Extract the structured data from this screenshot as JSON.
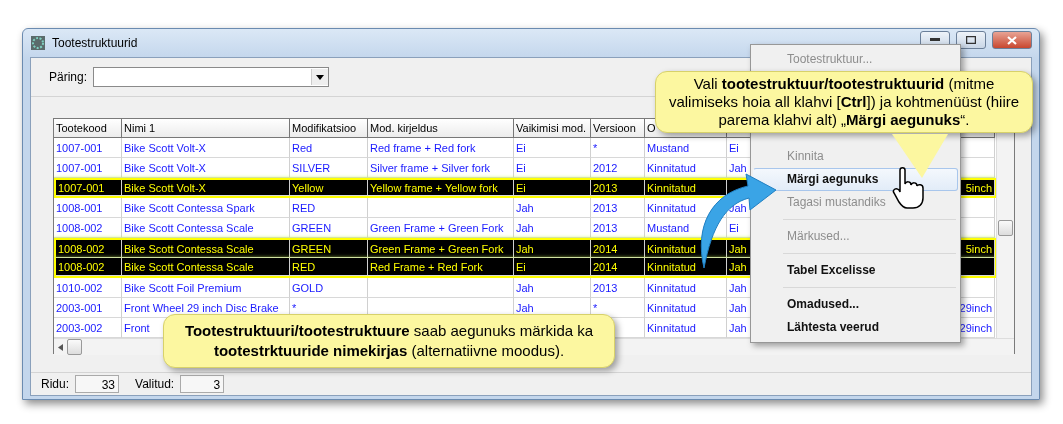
{
  "window": {
    "title": "Tootestruktuurid"
  },
  "query": {
    "label": "Päring:"
  },
  "table": {
    "columns": [
      "Tootekood",
      "Nimi 1",
      "Modifikatsioo",
      "Mod. kirjeldus",
      "Vaikimisi mod.",
      "Versioon",
      "O",
      null,
      null,
      null
    ],
    "rows": [
      {
        "selected": false,
        "cells": [
          "1007-001",
          "Bike Scott Volt-X",
          "Red",
          "Red frame + Red fork",
          "Ei",
          "*",
          "Mustand",
          "Ei",
          null,
          null
        ]
      },
      {
        "selected": false,
        "cells": [
          "1007-001",
          "Bike Scott Volt-X",
          "SILVER",
          "Silver frame + Silver fork",
          "Ei",
          "2012",
          "Kinnitatud",
          "Jah",
          null,
          null
        ]
      },
      {
        "selected": true,
        "cells": [
          "1007-001",
          "Bike Scott Volt-X",
          "Yellow",
          "Yellow frame + Yellow fork",
          "Ei",
          "2013",
          "Kinnitatud",
          null,
          null,
          "5inch"
        ]
      },
      {
        "selected": false,
        "cells": [
          "1008-001",
          "Bike Scott Contessa Spark",
          "RED",
          null,
          "Jah",
          "2013",
          "Kinnitatud",
          "Jah",
          null,
          null
        ]
      },
      {
        "selected": false,
        "cells": [
          "1008-002",
          "Bike Scott Contessa Scale",
          "GREEN",
          "Green Frame + Green Fork",
          "Jah",
          "2013",
          "Mustand",
          "Ei",
          null,
          null
        ]
      },
      {
        "selected": true,
        "cells": [
          "1008-002",
          "Bike Scott Contessa Scale",
          "GREEN",
          "Green Frame + Green Fork",
          "Jah",
          "2014",
          "Kinnitatud",
          "Jah",
          null,
          "5inch"
        ]
      },
      {
        "selected": true,
        "cells": [
          "1008-002",
          "Bike Scott Contessa Scale",
          "RED",
          "Red Frame + Red Fork",
          "Ei",
          "2014",
          "Kinnitatud",
          "Jah",
          null,
          null
        ]
      },
      {
        "selected": false,
        "cells": [
          "1010-002",
          "Bike Scott Foil Premium",
          "GOLD",
          null,
          "Jah",
          "2013",
          "Kinnitatud",
          "Jah",
          null,
          null
        ]
      },
      {
        "selected": false,
        "cells": [
          "2003-001",
          "Front Wheel 29 inch Disc Brake",
          "*",
          null,
          "Jah",
          "*",
          "Kinnitatud",
          "Jah",
          null,
          "29inch"
        ]
      },
      {
        "selected": false,
        "cells": [
          "2003-002",
          "Front",
          null,
          null,
          null,
          null,
          "Kinnitatud",
          "Jah",
          null,
          "29inch"
        ]
      }
    ]
  },
  "status": {
    "rows_label": "Ridu:",
    "rows_count": "33",
    "selected_label": "Valitud:",
    "selected_count": "3"
  },
  "context_menu": [
    {
      "kind": "item",
      "label": "Tootestruktuur...",
      "disabled": true,
      "selected": false
    },
    {
      "kind": "item",
      "label": "Kinnita",
      "disabled": true,
      "selected": false
    },
    {
      "kind": "item",
      "label": "Märgi aegunuks",
      "disabled": false,
      "selected": true
    },
    {
      "kind": "item",
      "label": "Tagasi mustandiks",
      "disabled": true,
      "selected": false
    },
    {
      "kind": "separator"
    },
    {
      "kind": "item",
      "label": "Märkused...",
      "disabled": true,
      "selected": false
    },
    {
      "kind": "separator"
    },
    {
      "kind": "item",
      "label": "Tabel Excelisse",
      "disabled": false,
      "selected": false
    },
    {
      "kind": "separator"
    },
    {
      "kind": "item",
      "label": "Omadused...",
      "disabled": false,
      "selected": false
    },
    {
      "kind": "item",
      "label": "Lähtesta veerud",
      "disabled": false,
      "selected": false
    }
  ],
  "callouts": [
    {
      "kind": "pointer",
      "text": "Vali **tootestruktuur/tootestruktuurid** (mitme valimiseks hoia all klahvi [**Ctrl**]) ja kohtmenüüst (hiire parema klahvi alt) „**Märgi aegunuks**“."
    },
    {
      "kind": "plain",
      "text": "**Tootestruktuuri/tootestruktuure** saab aegunuks märkida ka **tootestrktuuride nimekirjas** (alternatiivne moodus)."
    }
  ]
}
